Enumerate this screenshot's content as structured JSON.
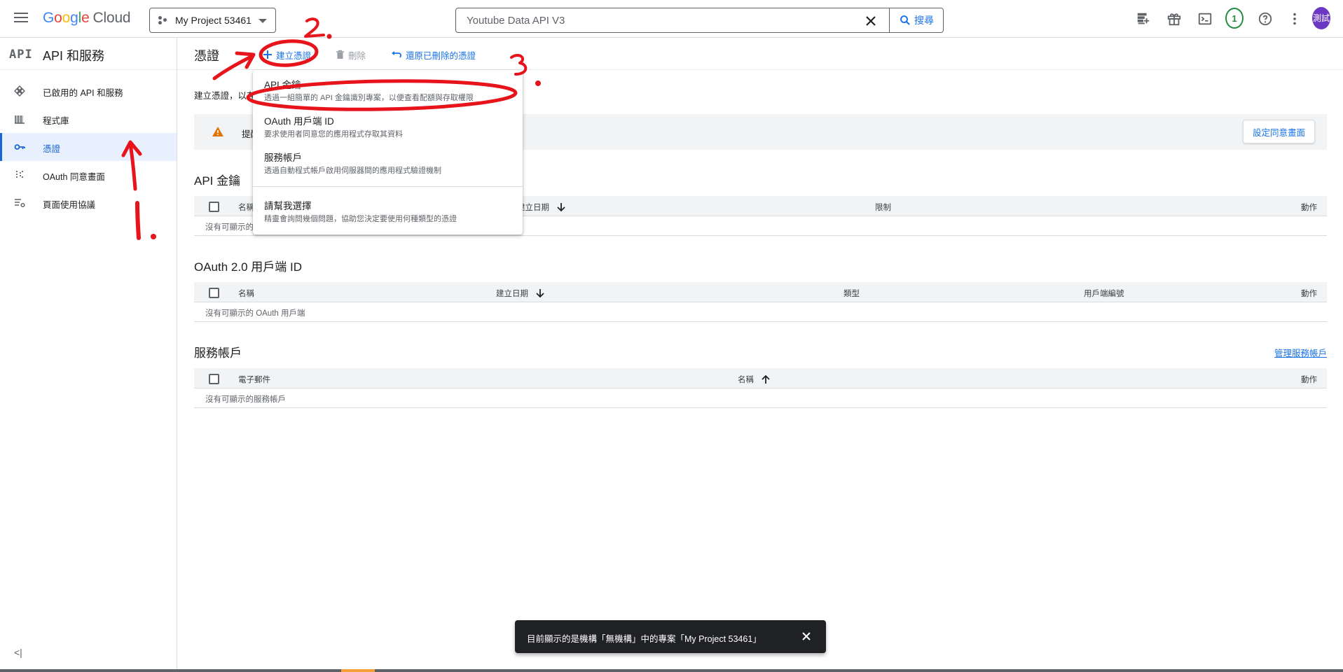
{
  "topbar": {
    "logo_google": "Google",
    "logo_cloud": "Cloud",
    "project_name": "My Project 53461",
    "search_value": "Youtube Data API V3",
    "search_button": "搜尋",
    "notifications_count": "1",
    "avatar_text": "測試"
  },
  "sidebar": {
    "api_logo": "API",
    "title": "API 和服務",
    "items": [
      {
        "label": "已啟用的 API 和服務",
        "icon": "apis-icon"
      },
      {
        "label": "程式庫",
        "icon": "library-icon"
      },
      {
        "label": "憑證",
        "icon": "key-icon",
        "active": true
      },
      {
        "label": "OAuth 同意畫面",
        "icon": "oauth-icon"
      },
      {
        "label": "頁面使用協議",
        "icon": "settings-list-icon"
      }
    ],
    "collapse_label": "<|"
  },
  "toolbar": {
    "page_title": "憑證",
    "create_label": "建立憑證",
    "delete_label": "刪除",
    "restore_label": "還原已刪除的憑證"
  },
  "main": {
    "intro_text": "建立憑證，以存",
    "notice_text": "提醒",
    "consent_button": "設定同意畫面"
  },
  "api_keys": {
    "title": "API 金鑰",
    "columns": [
      "名稱",
      "建立日期",
      "限制",
      "動作"
    ],
    "empty": "沒有可顯示的"
  },
  "oauth": {
    "title": "OAuth 2.0 用戶端 ID",
    "columns": [
      "名稱",
      "建立日期",
      "類型",
      "用戶端編號",
      "動作"
    ],
    "empty": "沒有可顯示的 OAuth 用戶端"
  },
  "service_accounts": {
    "title": "服務帳戶",
    "manage_link": "管理服務帳戶",
    "columns": [
      "電子郵件",
      "名稱",
      "動作"
    ],
    "empty": "沒有可顯示的服務帳戶"
  },
  "dropdown": {
    "items": [
      {
        "title": "API 金鑰",
        "desc": "透過一組簡單的 API 金鑰識別專案，以便查看配額與存取權限"
      },
      {
        "title": "OAuth 用戶端 ID",
        "desc": "要求使用者同意您的應用程式存取其資料"
      },
      {
        "title": "服務帳戶",
        "desc": "透過自動程式帳戶啟用伺服器間的應用程式驗證機制"
      },
      {
        "title": "請幫我選擇",
        "desc": "精靈會詢問幾個問題，協助您決定要使用何種類型的憑證"
      }
    ]
  },
  "snackbar": {
    "text": "目前顯示的是機構「無機構」中的專案「My Project 53461」"
  },
  "annotations": {
    "step1": "1.",
    "step2": "2.",
    "step3": "3.",
    "color": "#e8141b"
  },
  "colors": {
    "accent": "#1a73e8",
    "active_bg": "#e8f0fe",
    "warning": "#e37400",
    "annotation": "#e8141b"
  }
}
